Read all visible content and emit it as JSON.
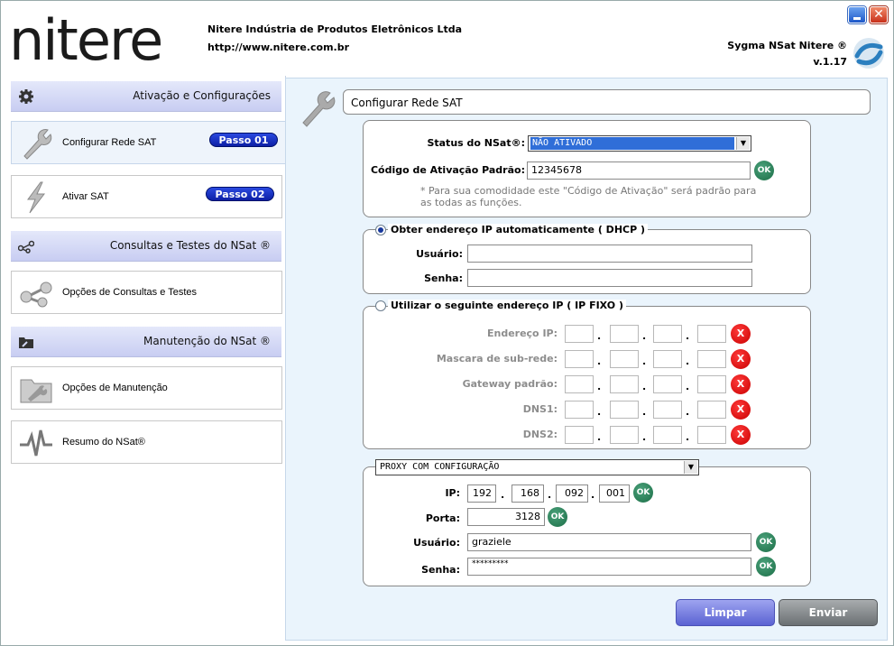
{
  "header": {
    "logo_text": "nitere",
    "company": "Nitere Indústria de Produtos Eletrônicos Ltda",
    "url": "http://www.nitere.com.br",
    "product": "Sygma NSat Nitere ®",
    "version": "v.1.17",
    "close_glyph": "✕"
  },
  "sidebar": {
    "sections": [
      {
        "title": "Ativação e Configurações",
        "icon": "gear-icon"
      },
      {
        "title": "Consultas e Testes do NSat ®",
        "icon": "share-icon"
      },
      {
        "title": "Manutenção do NSat ®",
        "icon": "folder-wrench-icon"
      }
    ],
    "items": [
      {
        "label": "Configurar Rede SAT",
        "badge": "Passo 01",
        "icon": "wrench-icon"
      },
      {
        "label": "Ativar SAT",
        "badge": "Passo 02",
        "icon": "lightning-icon"
      },
      {
        "label": "Opções de Consultas e Testes",
        "icon": "share-icon"
      },
      {
        "label": "Opções de Manutenção",
        "icon": "folder-wrench-icon"
      },
      {
        "label": "Resumo do NSat®",
        "icon": "pulse-icon"
      }
    ]
  },
  "main": {
    "title": "Configurar Rede SAT",
    "status_label": "Status do NSat®:",
    "status_value": "NÃO ATIVADO",
    "codigo_label": "Código de  Ativação Padrão:",
    "codigo_value": "12345678",
    "note": "* Para sua comodidade este \"Código de  Ativação\" será padrão para as todas as funções.",
    "ok": "OK",
    "x": "X",
    "dhcp": {
      "legend": "Obter endereço IP automaticamente ( DHCP )",
      "usuario_label": "Usuário:",
      "senha_label": "Senha:",
      "usuario_value": "",
      "senha_value": ""
    },
    "fixo": {
      "legend": "Utilizar o seguinte endereço IP ( IP FIXO )",
      "rows": [
        {
          "label": "Endereço IP:"
        },
        {
          "label": "Mascara de sub-rede:"
        },
        {
          "label": "Gateway padrão:"
        },
        {
          "label": "DNS1:"
        },
        {
          "label": "DNS2:"
        }
      ]
    },
    "proxy": {
      "mode": "PROXY COM CONFIGURAÇÃO",
      "ip_label": "IP:",
      "ip": [
        "192",
        "168",
        "092",
        "001"
      ],
      "porta_label": "Porta:",
      "porta_value": "3128",
      "usuario_label": "Usuário:",
      "usuario_value": "graziele",
      "senha_label": "Senha:",
      "senha_value": "*********"
    },
    "buttons": {
      "limpar": "Limpar",
      "enviar": "Enviar"
    }
  },
  "colors": {
    "accent_blue": "#1a33c4",
    "ok_green": "#1c6e47",
    "x_red": "#c90000",
    "panel_bg": "#eaf4fc"
  }
}
